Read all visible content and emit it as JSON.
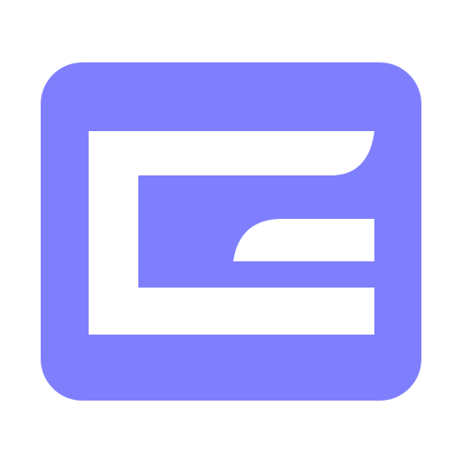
{
  "logo": {
    "icon": "app-logo-icon",
    "colors": {
      "tile": "#7f7ffe",
      "glyph": "#ffffff",
      "background": "#ffffff"
    }
  }
}
